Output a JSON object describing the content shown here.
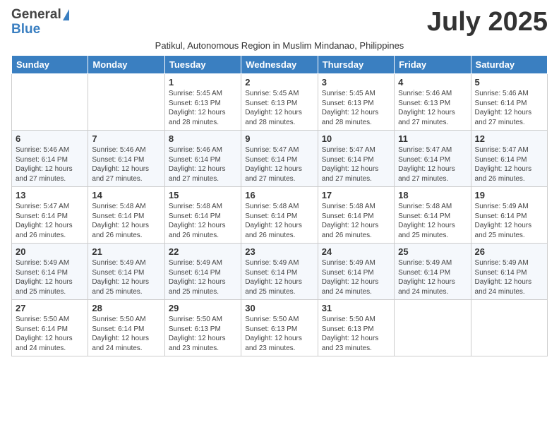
{
  "header": {
    "logo_general": "General",
    "logo_blue": "Blue",
    "month_title": "July 2025",
    "subtitle": "Patikul, Autonomous Region in Muslim Mindanao, Philippines"
  },
  "days_of_week": [
    "Sunday",
    "Monday",
    "Tuesday",
    "Wednesday",
    "Thursday",
    "Friday",
    "Saturday"
  ],
  "weeks": [
    [
      {
        "day": "",
        "info": ""
      },
      {
        "day": "",
        "info": ""
      },
      {
        "day": "1",
        "info": "Sunrise: 5:45 AM\nSunset: 6:13 PM\nDaylight: 12 hours and 28 minutes."
      },
      {
        "day": "2",
        "info": "Sunrise: 5:45 AM\nSunset: 6:13 PM\nDaylight: 12 hours and 28 minutes."
      },
      {
        "day": "3",
        "info": "Sunrise: 5:45 AM\nSunset: 6:13 PM\nDaylight: 12 hours and 28 minutes."
      },
      {
        "day": "4",
        "info": "Sunrise: 5:46 AM\nSunset: 6:13 PM\nDaylight: 12 hours and 27 minutes."
      },
      {
        "day": "5",
        "info": "Sunrise: 5:46 AM\nSunset: 6:14 PM\nDaylight: 12 hours and 27 minutes."
      }
    ],
    [
      {
        "day": "6",
        "info": "Sunrise: 5:46 AM\nSunset: 6:14 PM\nDaylight: 12 hours and 27 minutes."
      },
      {
        "day": "7",
        "info": "Sunrise: 5:46 AM\nSunset: 6:14 PM\nDaylight: 12 hours and 27 minutes."
      },
      {
        "day": "8",
        "info": "Sunrise: 5:46 AM\nSunset: 6:14 PM\nDaylight: 12 hours and 27 minutes."
      },
      {
        "day": "9",
        "info": "Sunrise: 5:47 AM\nSunset: 6:14 PM\nDaylight: 12 hours and 27 minutes."
      },
      {
        "day": "10",
        "info": "Sunrise: 5:47 AM\nSunset: 6:14 PM\nDaylight: 12 hours and 27 minutes."
      },
      {
        "day": "11",
        "info": "Sunrise: 5:47 AM\nSunset: 6:14 PM\nDaylight: 12 hours and 27 minutes."
      },
      {
        "day": "12",
        "info": "Sunrise: 5:47 AM\nSunset: 6:14 PM\nDaylight: 12 hours and 26 minutes."
      }
    ],
    [
      {
        "day": "13",
        "info": "Sunrise: 5:47 AM\nSunset: 6:14 PM\nDaylight: 12 hours and 26 minutes."
      },
      {
        "day": "14",
        "info": "Sunrise: 5:48 AM\nSunset: 6:14 PM\nDaylight: 12 hours and 26 minutes."
      },
      {
        "day": "15",
        "info": "Sunrise: 5:48 AM\nSunset: 6:14 PM\nDaylight: 12 hours and 26 minutes."
      },
      {
        "day": "16",
        "info": "Sunrise: 5:48 AM\nSunset: 6:14 PM\nDaylight: 12 hours and 26 minutes."
      },
      {
        "day": "17",
        "info": "Sunrise: 5:48 AM\nSunset: 6:14 PM\nDaylight: 12 hours and 26 minutes."
      },
      {
        "day": "18",
        "info": "Sunrise: 5:48 AM\nSunset: 6:14 PM\nDaylight: 12 hours and 25 minutes."
      },
      {
        "day": "19",
        "info": "Sunrise: 5:49 AM\nSunset: 6:14 PM\nDaylight: 12 hours and 25 minutes."
      }
    ],
    [
      {
        "day": "20",
        "info": "Sunrise: 5:49 AM\nSunset: 6:14 PM\nDaylight: 12 hours and 25 minutes."
      },
      {
        "day": "21",
        "info": "Sunrise: 5:49 AM\nSunset: 6:14 PM\nDaylight: 12 hours and 25 minutes."
      },
      {
        "day": "22",
        "info": "Sunrise: 5:49 AM\nSunset: 6:14 PM\nDaylight: 12 hours and 25 minutes."
      },
      {
        "day": "23",
        "info": "Sunrise: 5:49 AM\nSunset: 6:14 PM\nDaylight: 12 hours and 25 minutes."
      },
      {
        "day": "24",
        "info": "Sunrise: 5:49 AM\nSunset: 6:14 PM\nDaylight: 12 hours and 24 minutes."
      },
      {
        "day": "25",
        "info": "Sunrise: 5:49 AM\nSunset: 6:14 PM\nDaylight: 12 hours and 24 minutes."
      },
      {
        "day": "26",
        "info": "Sunrise: 5:49 AM\nSunset: 6:14 PM\nDaylight: 12 hours and 24 minutes."
      }
    ],
    [
      {
        "day": "27",
        "info": "Sunrise: 5:50 AM\nSunset: 6:14 PM\nDaylight: 12 hours and 24 minutes."
      },
      {
        "day": "28",
        "info": "Sunrise: 5:50 AM\nSunset: 6:14 PM\nDaylight: 12 hours and 24 minutes."
      },
      {
        "day": "29",
        "info": "Sunrise: 5:50 AM\nSunset: 6:13 PM\nDaylight: 12 hours and 23 minutes."
      },
      {
        "day": "30",
        "info": "Sunrise: 5:50 AM\nSunset: 6:13 PM\nDaylight: 12 hours and 23 minutes."
      },
      {
        "day": "31",
        "info": "Sunrise: 5:50 AM\nSunset: 6:13 PM\nDaylight: 12 hours and 23 minutes."
      },
      {
        "day": "",
        "info": ""
      },
      {
        "day": "",
        "info": ""
      }
    ]
  ]
}
